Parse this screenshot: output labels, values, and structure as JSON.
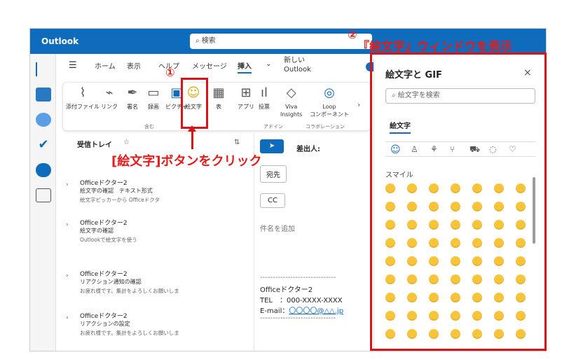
{
  "titlebar": {
    "app_name": "Outlook",
    "search_placeholder": "検索"
  },
  "menu": {
    "items": [
      "ホーム",
      "表示",
      "ヘルプ",
      "メッセージ",
      "挿入"
    ],
    "new_outlook_line1": "新しい",
    "new_outlook_line2": "Outlook"
  },
  "ribbon": {
    "buttons": [
      {
        "label": "添付ファイル",
        "icon": "paperclip-icon"
      },
      {
        "label": "リンク",
        "icon": "link-icon"
      },
      {
        "label": "署名",
        "icon": "signature-icon"
      },
      {
        "label": "録画",
        "icon": "video-icon"
      },
      {
        "label": "ピクチャ",
        "icon": "picture-icon"
      },
      {
        "label": "絵文字",
        "icon": "emoji-icon"
      },
      {
        "label": "表",
        "icon": "table-icon"
      },
      {
        "label": "アプリ",
        "icon": "apps-icon"
      },
      {
        "label": "投票",
        "icon": "poll-icon"
      },
      {
        "label": "Viva",
        "label2": "Insights",
        "icon": "viva-icon"
      },
      {
        "label": "Loop",
        "label2": "コンポーネント",
        "icon": "loop-icon"
      }
    ],
    "groups": [
      "含む",
      "アドイン",
      "コラボレーション"
    ]
  },
  "list": {
    "folder": "受信トレイ",
    "items": [
      {
        "sender": "Officeドクター2",
        "subject": "絵文字の確認　テキスト形式",
        "preview": "絵文字ピッカーから Officeドクタ"
      },
      {
        "sender": "Officeドクター2",
        "subject": "絵文字の確認",
        "preview": "Outlookで絵文字を使う"
      },
      {
        "sender": "Officeドクター2",
        "subject": "リアクション通知の確認",
        "preview": "お疲れ様です。集計をよろしくお願いしま"
      },
      {
        "sender": "Officeドクター2",
        "subject": "リアクションの設定",
        "preview": "お疲れ様です。集計をよろしくお願いしま"
      }
    ]
  },
  "compose": {
    "from_label": "差出人:",
    "to_button": "宛先",
    "cc_button": "CC",
    "subject_placeholder": "件名を追加",
    "signature": {
      "line1": "Officeドクター2",
      "line2": "TEL　：000-XXXX-XXXX",
      "line3_prefix": "E-mail：",
      "line3_link": "〇〇〇〇@△△.jp"
    },
    "separator": "------------------------------"
  },
  "emoji_panel": {
    "title": "絵文字と GIF",
    "search_placeholder": "絵文字を検索",
    "tab": "絵文字",
    "category": "スマイル",
    "close": "×"
  },
  "annotations": {
    "step1": "①",
    "step2": "②",
    "callout1": "[絵文字]ボタンをクリック",
    "callout2": "『絵文字』ウィンドウを表示"
  }
}
